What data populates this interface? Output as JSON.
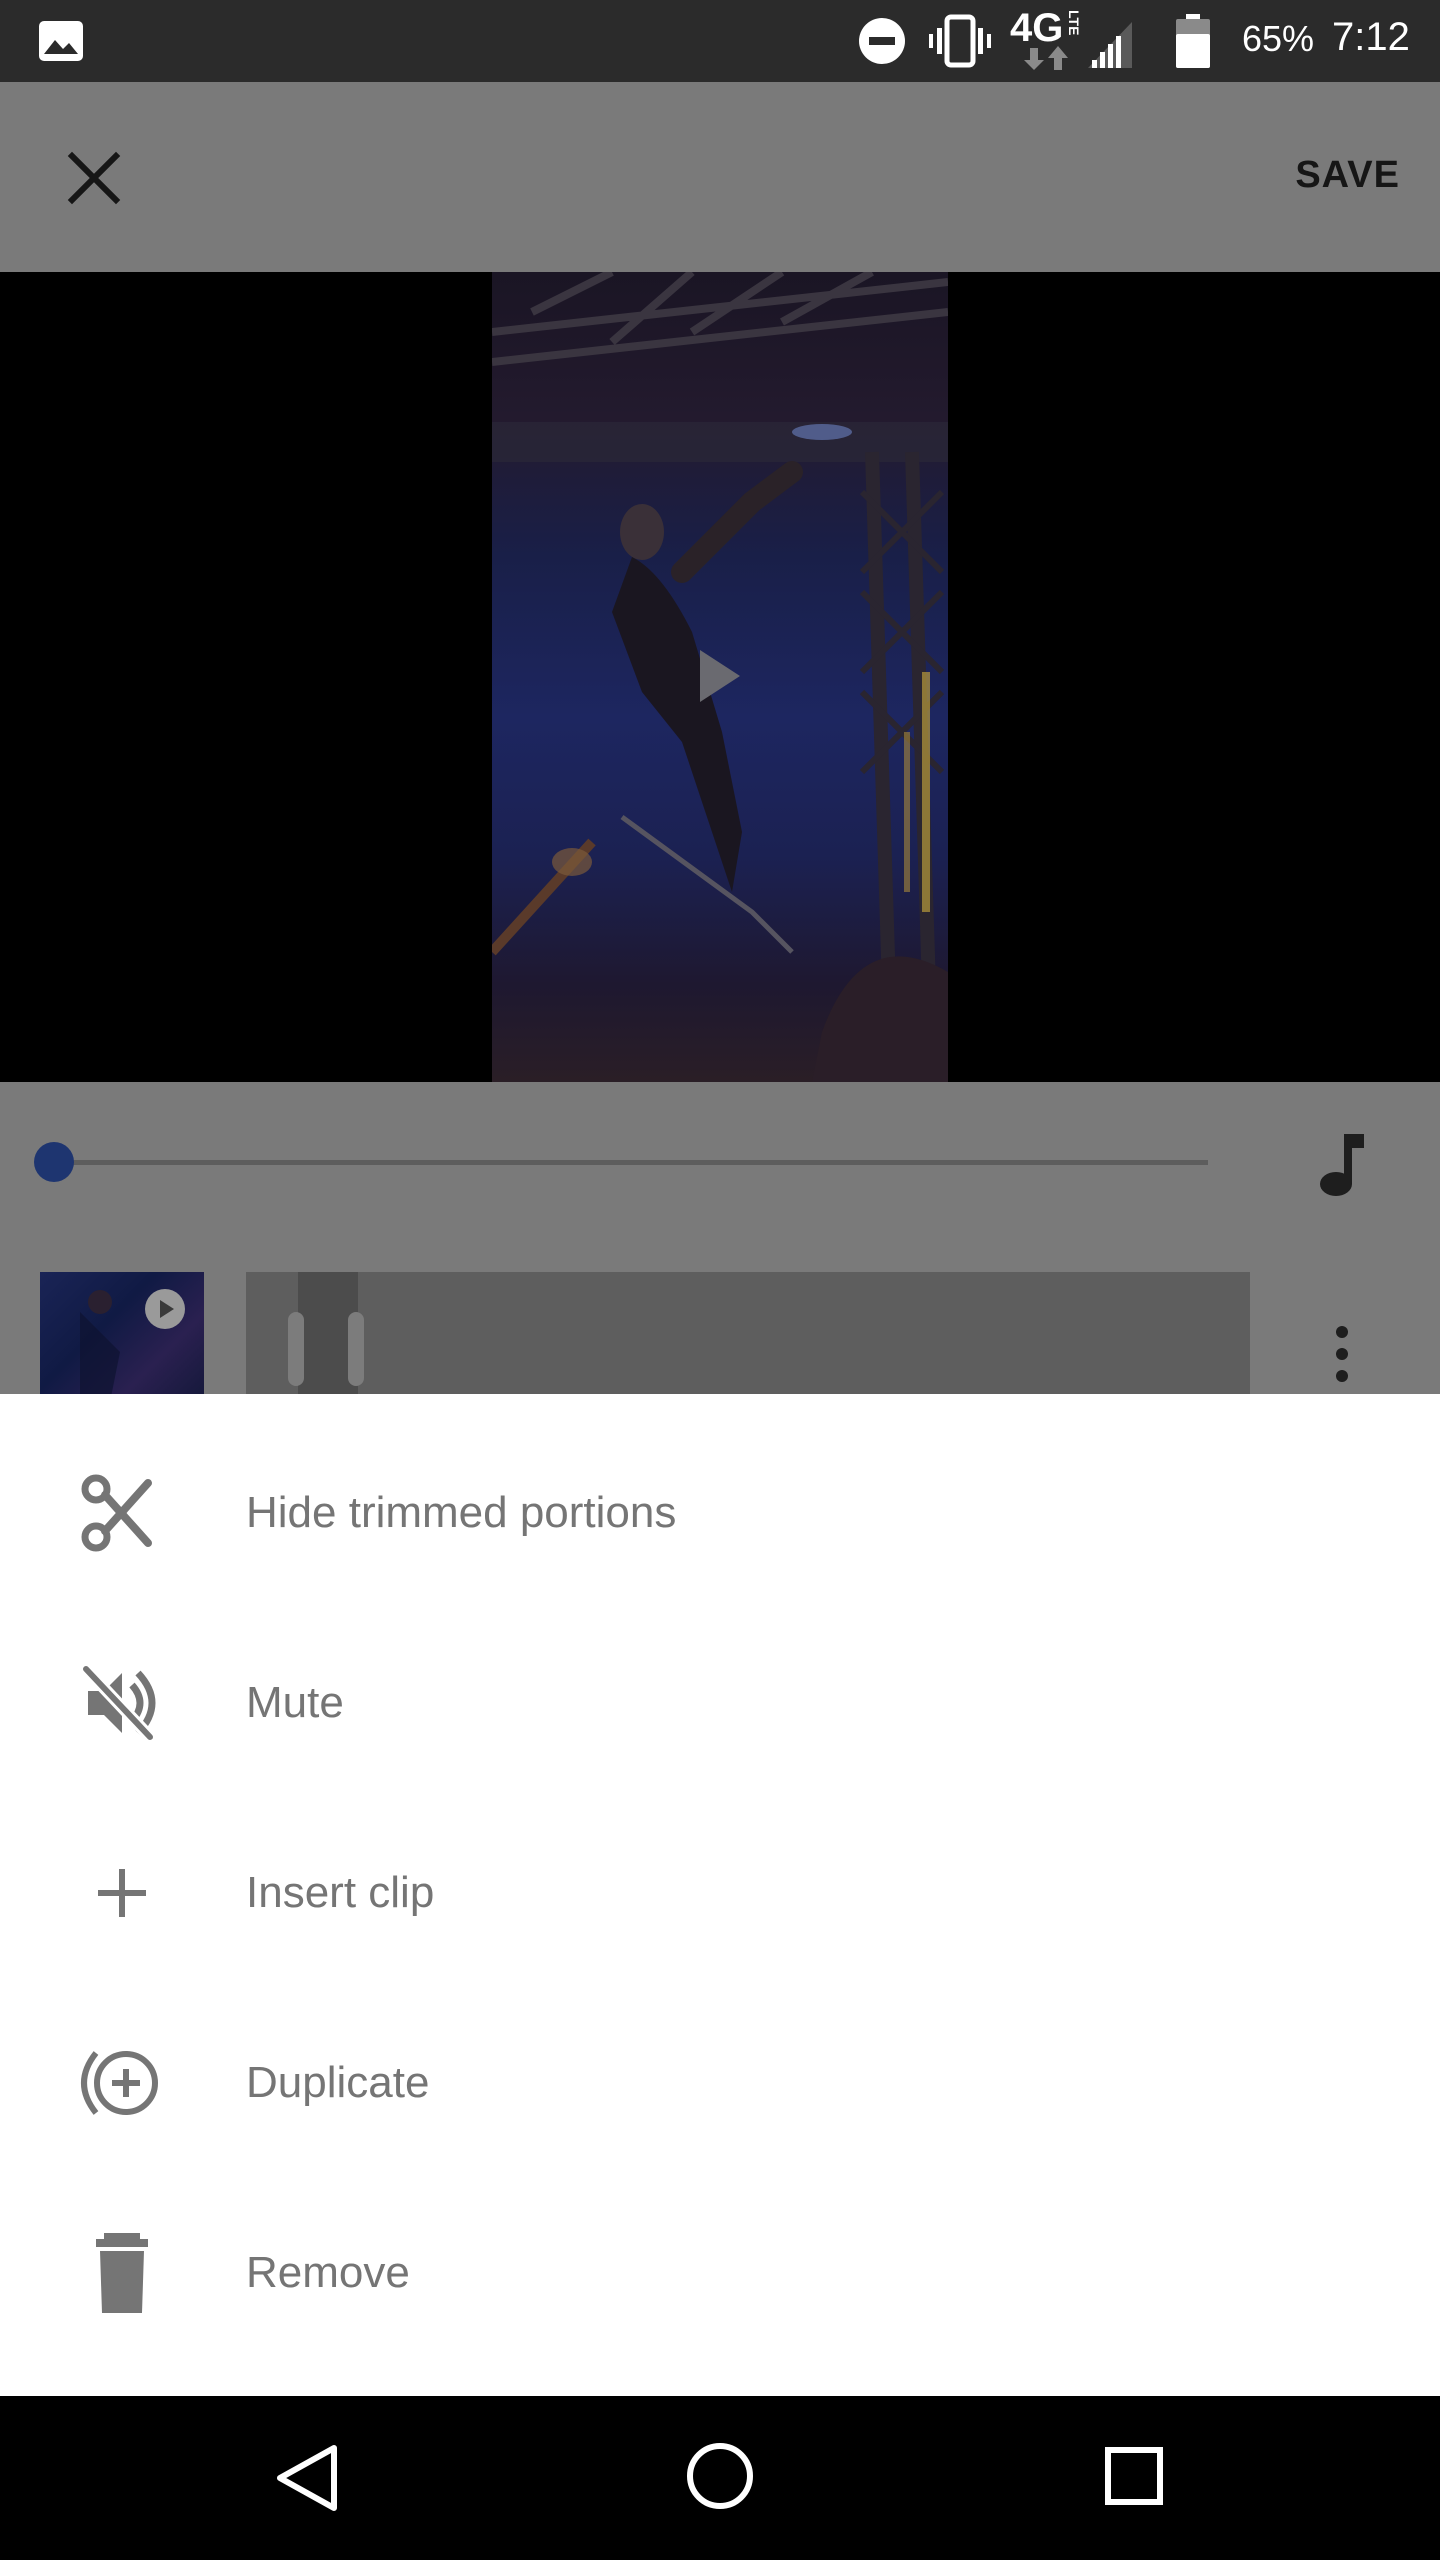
{
  "status_bar": {
    "network": "4G",
    "network_sub": "LTE",
    "battery": "65%",
    "time": "7:12"
  },
  "app_bar": {
    "close_icon": "close-icon",
    "save_label": "SAVE"
  },
  "editor": {
    "seek_progress": 0.0,
    "music_icon": "music-note-icon",
    "more_icon": "more-vert-icon"
  },
  "menu": {
    "items": [
      {
        "label": "Hide trimmed portions",
        "icon": "scissors-icon"
      },
      {
        "label": "Mute",
        "icon": "volume-off-icon"
      },
      {
        "label": "Insert clip",
        "icon": "plus-icon"
      },
      {
        "label": "Duplicate",
        "icon": "duplicate-icon"
      },
      {
        "label": "Remove",
        "icon": "trash-icon"
      }
    ]
  },
  "colors": {
    "sheet_text": "#757575",
    "accent_dimmed": "#1e3570"
  }
}
